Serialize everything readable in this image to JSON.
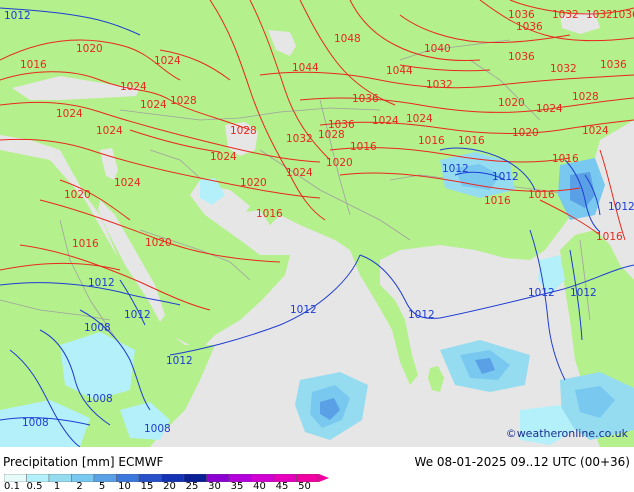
{
  "map": {
    "colors": {
      "land": "#b4f08c",
      "sea": "#e6e6e6",
      "high_pressure": "#e8281e",
      "low_pressure": "#1e3cd2",
      "borders": "#a0a0a0"
    },
    "isobar_labels": [
      {
        "text": "1012",
        "color": "blue"
      },
      {
        "text": "1020",
        "color": "red"
      },
      {
        "text": "1016",
        "color": "red"
      },
      {
        "text": "1024",
        "color": "red"
      },
      {
        "text": "1024",
        "color": "red"
      },
      {
        "text": "1024",
        "color": "red"
      },
      {
        "text": "1028",
        "color": "red"
      },
      {
        "text": "1024",
        "color": "red"
      },
      {
        "text": "1024",
        "color": "red"
      },
      {
        "text": "1024",
        "color": "red"
      },
      {
        "text": "1028",
        "color": "red"
      },
      {
        "text": "1024",
        "color": "red"
      },
      {
        "text": "1024",
        "color": "red"
      },
      {
        "text": "1020",
        "color": "red"
      },
      {
        "text": "1020",
        "color": "red"
      },
      {
        "text": "1016",
        "color": "red"
      },
      {
        "text": "1020",
        "color": "red"
      },
      {
        "text": "1016",
        "color": "red"
      },
      {
        "text": "1012",
        "color": "blue"
      },
      {
        "text": "1012",
        "color": "blue"
      },
      {
        "text": "1008",
        "color": "blue"
      },
      {
        "text": "1012",
        "color": "blue"
      },
      {
        "text": "1008",
        "color": "blue"
      },
      {
        "text": "1008",
        "color": "blue"
      },
      {
        "text": "1008",
        "color": "blue"
      },
      {
        "text": "1048",
        "color": "red"
      },
      {
        "text": "1044",
        "color": "red"
      },
      {
        "text": "1040",
        "color": "red"
      },
      {
        "text": "1044",
        "color": "red"
      },
      {
        "text": "1036",
        "color": "red"
      },
      {
        "text": "1032",
        "color": "red"
      },
      {
        "text": "1036",
        "color": "red"
      },
      {
        "text": "1036",
        "color": "red"
      },
      {
        "text": "1032",
        "color": "red"
      },
      {
        "text": "1036",
        "color": "red"
      },
      {
        "text": "1036",
        "color": "red"
      },
      {
        "text": "1028",
        "color": "red"
      },
      {
        "text": "1032",
        "color": "red"
      },
      {
        "text": "1036",
        "color": "red"
      },
      {
        "text": "1032",
        "color": "red"
      },
      {
        "text": "1024",
        "color": "red"
      },
      {
        "text": "1024",
        "color": "red"
      },
      {
        "text": "1020",
        "color": "red"
      },
      {
        "text": "1016",
        "color": "red"
      },
      {
        "text": "1020",
        "color": "red"
      },
      {
        "text": "1024",
        "color": "red"
      },
      {
        "text": "1020",
        "color": "red"
      },
      {
        "text": "1028",
        "color": "red"
      },
      {
        "text": "1016",
        "color": "red"
      },
      {
        "text": "1024",
        "color": "red"
      },
      {
        "text": "1012",
        "color": "blue"
      },
      {
        "text": "1012",
        "color": "blue"
      },
      {
        "text": "1016",
        "color": "red"
      },
      {
        "text": "1016",
        "color": "red"
      },
      {
        "text": "1016",
        "color": "red"
      },
      {
        "text": "1012",
        "color": "blue"
      },
      {
        "text": "1012",
        "color": "blue"
      },
      {
        "text": "1012",
        "color": "blue"
      },
      {
        "text": "1012",
        "color": "blue"
      },
      {
        "text": "1012",
        "color": "blue"
      },
      {
        "text": "1016",
        "color": "red"
      },
      {
        "text": "1016",
        "color": "red"
      },
      {
        "text": "1032",
        "color": "red"
      },
      {
        "text": "1036",
        "color": "red"
      }
    ]
  },
  "footer": {
    "title": "Precipitation [mm] ECMWF",
    "datetime": "We 08-01-2025 09..12 UTC (00+36)",
    "credit": "©weatheronline.co.uk"
  },
  "legend": {
    "labels": [
      "0.1",
      "0.5",
      "1",
      "2",
      "5",
      "10",
      "15",
      "20",
      "25",
      "30",
      "35",
      "40",
      "45",
      "50"
    ],
    "colors": [
      "#e6fafa",
      "#b4f0fa",
      "#96dcf0",
      "#78c8f0",
      "#5aa0e6",
      "#3c78dc",
      "#2850c8",
      "#1432b4",
      "#0a1e96",
      "#8c00d2",
      "#b400dc",
      "#d200d2",
      "#e600be",
      "#f000a0"
    ]
  }
}
